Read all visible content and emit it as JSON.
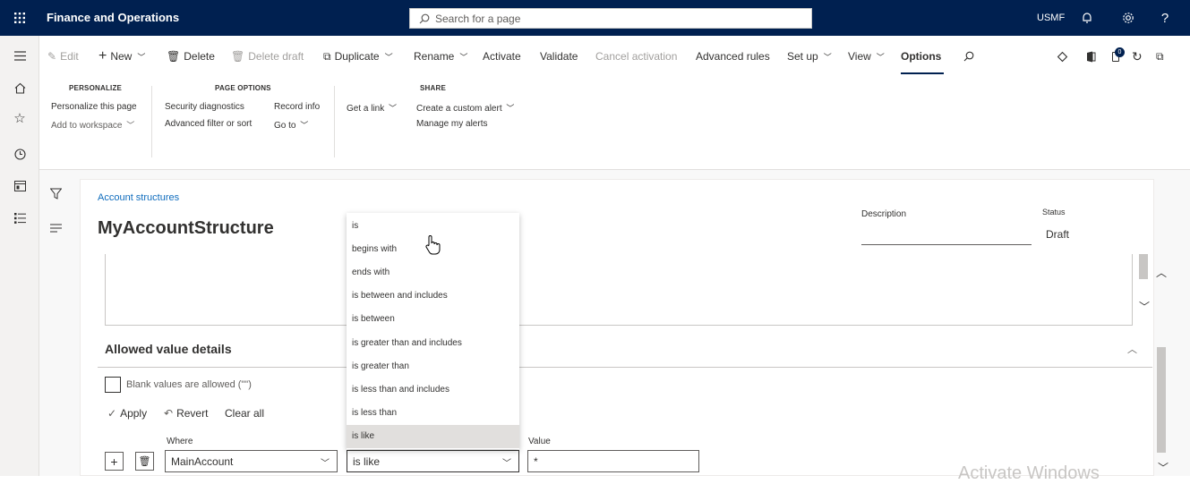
{
  "topbar": {
    "app_title": "Finance and Operations",
    "search_placeholder": "Search for a page",
    "company": "USMF",
    "icons": [
      "waffle-icon",
      "search-icon",
      "bell-icon",
      "gear-icon",
      "help-icon"
    ]
  },
  "actions": {
    "edit": "Edit",
    "new": "New",
    "delete": "Delete",
    "delete_draft": "Delete draft",
    "duplicate": "Duplicate",
    "rename": "Rename",
    "activate": "Activate",
    "validate": "Validate",
    "cancel_activation": "Cancel activation",
    "advanced_rules": "Advanced rules",
    "set_up": "Set up",
    "view": "View",
    "options": "Options",
    "notification_count": "0"
  },
  "ribbon": {
    "personalize": {
      "header": "PERSONALIZE",
      "personalize_page": "Personalize this page",
      "add_to_workspace": "Add to workspace"
    },
    "page_options": {
      "header": "PAGE OPTIONS",
      "security_diagnostics": "Security diagnostics",
      "record_info": "Record info",
      "advanced_filter": "Advanced filter or sort",
      "go_to": "Go to"
    },
    "get_link": "Get a link",
    "share": {
      "header": "SHARE",
      "create_alert": "Create a custom alert",
      "manage_alerts": "Manage my alerts"
    }
  },
  "page": {
    "breadcrumb": "Account structures",
    "title": "MyAccountStructure",
    "description_label": "Description",
    "description_value": "",
    "status_label": "Status",
    "status_value": "Draft"
  },
  "allowed_values": {
    "title": "Allowed value details",
    "blank_values_label": "Blank values are allowed (\"\")",
    "apply": "Apply",
    "revert": "Revert",
    "clear_all": "Clear all",
    "where_label": "Where",
    "where_value": "MainAccount",
    "operator_value": "is like",
    "value_label": "Value",
    "value_value": "*"
  },
  "operator_options": [
    "is",
    "begins with",
    "ends with",
    "is between and includes",
    "is between",
    "is greater than and includes",
    "is greater than",
    "is less than and includes",
    "is less than",
    "is like"
  ],
  "selected_operator_index": 9,
  "watermark": "Activate Windows"
}
